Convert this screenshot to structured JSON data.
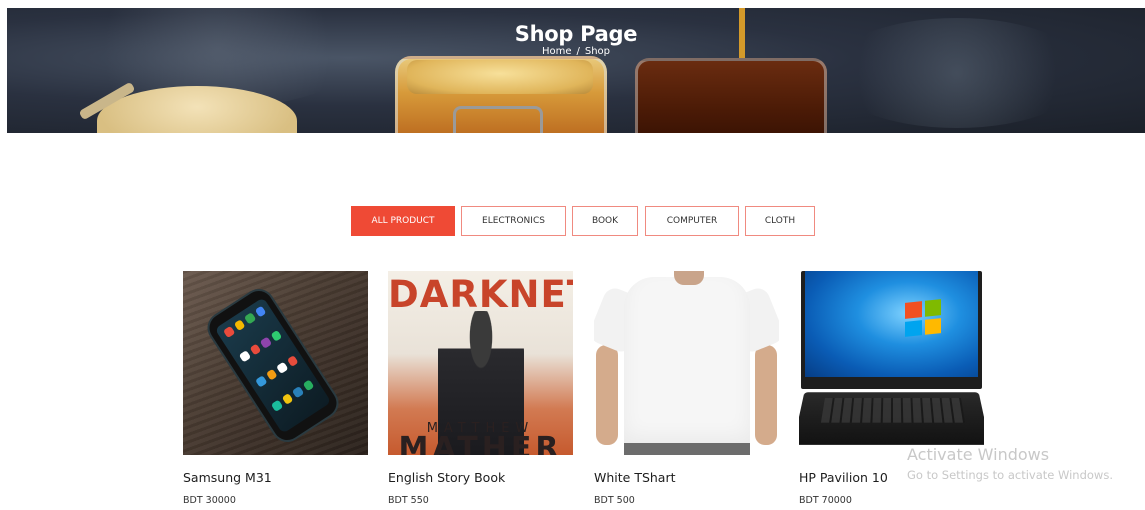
{
  "hero": {
    "title": "Shop Page",
    "breadcrumb": {
      "home": "Home",
      "separator": "/",
      "current": "Shop"
    }
  },
  "filters": {
    "active_color": "#ef4a35",
    "items": [
      {
        "label": "ALL PRODUCT",
        "active": true
      },
      {
        "label": "ELECTRONICS",
        "active": false
      },
      {
        "label": "BOOK",
        "active": false
      },
      {
        "label": "COMPUTER",
        "active": false
      },
      {
        "label": "CLOTH",
        "active": false
      }
    ]
  },
  "products": [
    {
      "name": "Samsung M31",
      "price": "BDT 30000",
      "image": "smartphone-image"
    },
    {
      "name": "English Story Book",
      "price": "BDT 550",
      "image": "book-cover-image",
      "cover": {
        "title": "DARKNET",
        "author_first": "MATTHEW",
        "author_last": "MATHER"
      }
    },
    {
      "name": "White TShart",
      "price": "BDT 500",
      "image": "tshirt-image"
    },
    {
      "name": "HP Pavilion 10",
      "price": "BDT 70000",
      "image": "laptop-image"
    }
  ],
  "watermark": {
    "line1": "Activate Windows",
    "line2": "Go to Settings to activate Windows."
  }
}
